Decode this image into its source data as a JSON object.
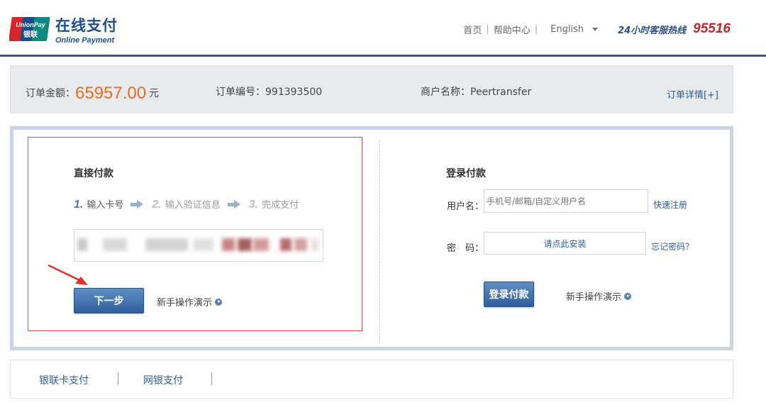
{
  "header": {
    "logo_badge_top": "UnionPay",
    "logo_badge_bottom": "银联",
    "logo_title": "在线支付",
    "logo_subtitle": "Online Payment",
    "nav": [
      "首页",
      "帮助中心"
    ],
    "language": "English",
    "hotline_label": "24小时客服热线",
    "hotline_number": "95516"
  },
  "order": {
    "amount_label": "订单金额：",
    "amount_value": "65957.00",
    "amount_unit": "元",
    "order_no_label": "订单编号：",
    "order_no_value": "991393500",
    "merchant_label": "商户名称：",
    "merchant_value": "Peertransfer",
    "detail_link": "订单详情[+]"
  },
  "direct": {
    "title": "直接付款",
    "steps": [
      {
        "num": "1.",
        "label": "输入卡号"
      },
      {
        "num": "2.",
        "label": "输入验证信息"
      },
      {
        "num": "3.",
        "label": "完成支付"
      }
    ],
    "next_button": "下一步",
    "guide_link": "新手操作演示"
  },
  "login": {
    "title": "登录付款",
    "username_label": "用户名：",
    "username_placeholder": "手机号/邮箱/自定义用户名",
    "register_link": "快速注册",
    "password_label": "密　码：",
    "password_value": "请点此安装",
    "forgot_link": "忘记密码？",
    "login_button": "登录付款",
    "guide_link": "新手操作演示"
  },
  "tabs": [
    "银联卡支付",
    "网银支付"
  ],
  "colors": {
    "amount": "#f06a1d",
    "link": "#2d5c9a",
    "button": "#2f5f9c",
    "highlight_border": "#c9534f",
    "hotline": "#c0282e"
  }
}
